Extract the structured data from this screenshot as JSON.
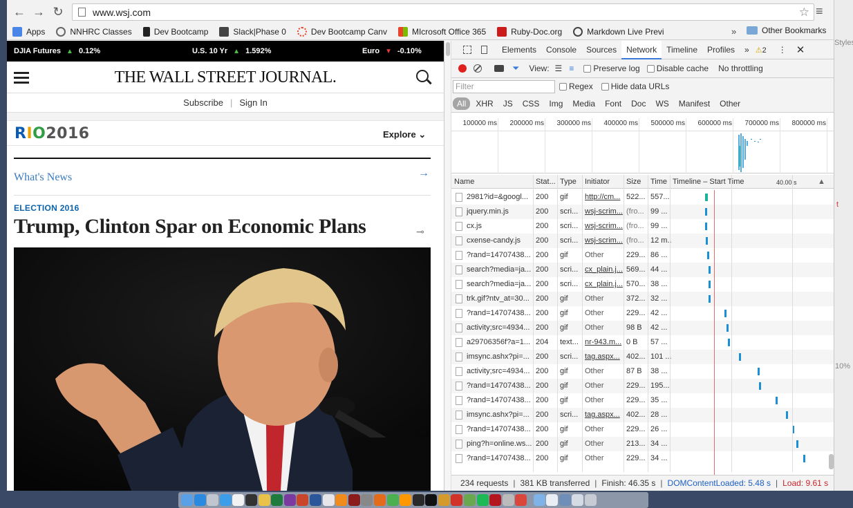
{
  "browser": {
    "url": "www.wsj.com",
    "bookmarks": [
      {
        "label": "Apps",
        "color": "#4a86e8"
      },
      {
        "label": "NNHRC Classes",
        "color": "#666666"
      },
      {
        "label": "Dev Bootcamp",
        "color": "#222222"
      },
      {
        "label": "Slack|Phase 0",
        "color": "#333333"
      },
      {
        "label": "Dev Bootcamp Canv",
        "color": "#e8452c"
      },
      {
        "label": "MIcrosoft Office 365",
        "color": "#e8452c"
      },
      {
        "label": "Ruby-Doc.org",
        "color": "#cc1b1b"
      },
      {
        "label": "Markdown Live Previ",
        "color": "#444444"
      }
    ],
    "bookmarks_more": "»",
    "other_bookmarks": "Other Bookmarks"
  },
  "wsj": {
    "tickers": [
      {
        "name": "DJIA Futures",
        "dir": "up",
        "value": "0.12%"
      },
      {
        "name": "U.S. 10 Yr",
        "dir": "up",
        "value": "1.592%"
      },
      {
        "name": "Euro",
        "dir": "down",
        "value": "-0.10%"
      }
    ],
    "masthead": "THE WALL STREET JOURNAL.",
    "subscribe": "Subscribe",
    "signin": "Sign In",
    "rio_logo": "RIO2016",
    "explore": "Explore",
    "whats_news": "What's News",
    "kicker": "ELECTION 2016",
    "headline": "Trump, Clinton Spar on Economic Plans"
  },
  "devtools": {
    "tabs": [
      "Elements",
      "Console",
      "Sources",
      "Network",
      "Timeline",
      "Profiles"
    ],
    "active_tab": "Network",
    "warnings": "2",
    "view_label": "View:",
    "preserve_log": "Preserve log",
    "disable_cache": "Disable cache",
    "throttling": "No throttling",
    "filter_placeholder": "Filter",
    "regex": "Regex",
    "hide_data_urls": "Hide data URLs",
    "types": [
      "All",
      "XHR",
      "JS",
      "CSS",
      "Img",
      "Media",
      "Font",
      "Doc",
      "WS",
      "Manifest",
      "Other"
    ],
    "overview_ticks": [
      "100000 ms",
      "200000 ms",
      "300000 ms",
      "400000 ms",
      "500000 ms",
      "600000 ms",
      "700000 ms",
      "800000 ms"
    ],
    "columns": {
      "name": "Name",
      "status": "Stat...",
      "type": "Type",
      "initiator": "Initiator",
      "size": "Size",
      "time": "Time",
      "timeline": "Timeline – Start Time",
      "timeline_scale": "40.00 s"
    },
    "requests": [
      {
        "name": "2981?id=&googl...",
        "status": "200",
        "type": "gif",
        "initiator": "http://cm...",
        "init_link": true,
        "size": "522...",
        "time": "557..."
      },
      {
        "name": "jquery.min.js",
        "status": "200",
        "type": "scri...",
        "initiator": "wsj-scrim...",
        "init_link": true,
        "size": "(fro...",
        "time": "99 ..."
      },
      {
        "name": "cx.js",
        "status": "200",
        "type": "scri...",
        "initiator": "wsj-scrim...",
        "init_link": true,
        "size": "(fro...",
        "time": "99 ..."
      },
      {
        "name": "cxense-candy.js",
        "status": "200",
        "type": "scri...",
        "initiator": "wsj-scrim...",
        "init_link": true,
        "size": "(fro...",
        "time": "12 m..."
      },
      {
        "name": "?rand=14707438...",
        "status": "200",
        "type": "gif",
        "initiator": "Other",
        "init_link": false,
        "size": "229...",
        "time": "86 ..."
      },
      {
        "name": "search?media=ja...",
        "status": "200",
        "type": "scri...",
        "initiator": "cx_plain.j...",
        "init_link": true,
        "size": "569...",
        "time": "44 ..."
      },
      {
        "name": "search?media=ja...",
        "status": "200",
        "type": "scri...",
        "initiator": "cx_plain.j...",
        "init_link": true,
        "size": "570...",
        "time": "38 ..."
      },
      {
        "name": "trk.gif?ntv_at=30...",
        "status": "200",
        "type": "gif",
        "initiator": "Other",
        "init_link": false,
        "size": "372...",
        "time": "32 ..."
      },
      {
        "name": "?rand=14707438...",
        "status": "200",
        "type": "gif",
        "initiator": "Other",
        "init_link": false,
        "size": "229...",
        "time": "42 ..."
      },
      {
        "name": "activity;src=4934...",
        "status": "200",
        "type": "gif",
        "initiator": "Other",
        "init_link": false,
        "size": "98 B",
        "time": "42 ..."
      },
      {
        "name": "a29706356f?a=1...",
        "status": "204",
        "type": "text...",
        "initiator": "nr-943.m...",
        "init_link": true,
        "size": "0 B",
        "time": "57 ..."
      },
      {
        "name": "imsync.ashx?pi=...",
        "status": "200",
        "type": "scri...",
        "initiator": "tag.aspx...",
        "init_link": true,
        "size": "402...",
        "time": "101 ..."
      },
      {
        "name": "activity;src=4934...",
        "status": "200",
        "type": "gif",
        "initiator": "Other",
        "init_link": false,
        "size": "87 B",
        "time": "38 ..."
      },
      {
        "name": "?rand=14707438...",
        "status": "200",
        "type": "gif",
        "initiator": "Other",
        "init_link": false,
        "size": "229...",
        "time": "195..."
      },
      {
        "name": "?rand=14707438...",
        "status": "200",
        "type": "gif",
        "initiator": "Other",
        "init_link": false,
        "size": "229...",
        "time": "35 ..."
      },
      {
        "name": "imsync.ashx?pi=...",
        "status": "200",
        "type": "scri...",
        "initiator": "tag.aspx...",
        "init_link": true,
        "size": "402...",
        "time": "28 ..."
      },
      {
        "name": "?rand=14707438...",
        "status": "200",
        "type": "gif",
        "initiator": "Other",
        "init_link": false,
        "size": "229...",
        "time": "26 ..."
      },
      {
        "name": "ping?h=online.ws...",
        "status": "200",
        "type": "gif",
        "initiator": "Other",
        "init_link": false,
        "size": "213...",
        "time": "34 ..."
      },
      {
        "name": "?rand=14707438...",
        "status": "200",
        "type": "gif",
        "initiator": "Other",
        "init_link": false,
        "size": "229...",
        "time": "34 ..."
      }
    ],
    "status_bar": {
      "requests": "234 requests",
      "transferred": "381 KB transferred",
      "finish": "Finish: 46.35 s",
      "dom_loaded": "DOMContentLoaded: 5.48 s",
      "load": "Load: 9.61 s"
    }
  },
  "side_panel": {
    "styles": "Styles",
    "zoom": "10%",
    "marker": "t"
  }
}
